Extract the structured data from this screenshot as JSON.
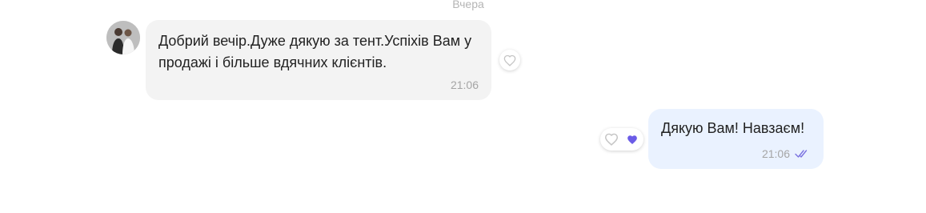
{
  "date_separator": "Вчера",
  "colors": {
    "incoming_bubble": "#f3f3f3",
    "outgoing_bubble": "#eaf2ff",
    "heart_filled": "#6b5ce7",
    "read_check": "#7b72e0"
  },
  "messages": [
    {
      "direction": "incoming",
      "text": "Добрий вечір.Дуже дякую за тент.Успіхів Вам у продажі і більше вдячних клієнтів.",
      "time": "21:06",
      "reaction_icon": "heart-outline-icon"
    },
    {
      "direction": "outgoing",
      "text": "Дякую Вам! Навзаєм!",
      "time": "21:06",
      "status_icon": "double-check-icon",
      "reactions": [
        "heart-outline-icon",
        "heart-filled-icon"
      ]
    }
  ]
}
